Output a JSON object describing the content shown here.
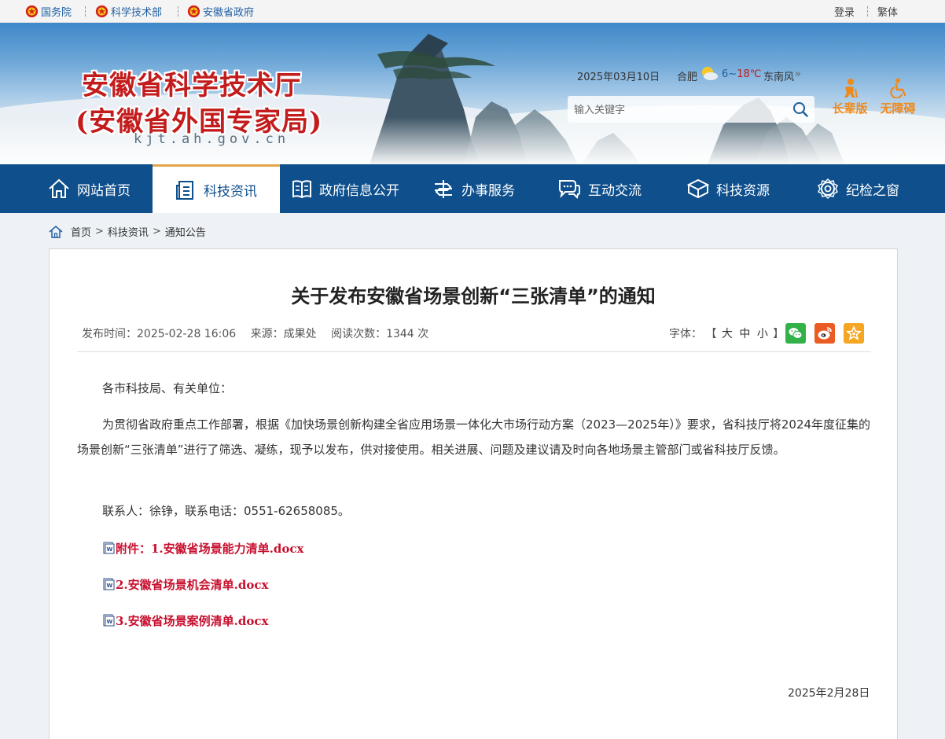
{
  "topbar": {
    "links": [
      "国务院",
      "科学技术部",
      "安徽省政府"
    ],
    "login": "登录",
    "traditional": "繁体"
  },
  "header": {
    "title_line1": "安徽省科学技术厅",
    "title_line2": "(安徽省外国专家局)",
    "domain": "kjt.ah.gov.cn",
    "date": "2025年03月10日",
    "city": "合肥",
    "temp_low": "6",
    "temp_sep": "~",
    "temp_high": "18",
    "temp_unit": "℃",
    "wind": "东南风",
    "wind_more": "»",
    "search_placeholder": "输入关键字",
    "elder_label": "长辈版",
    "accessible_label": "无障碍",
    "colors": {
      "title_red": "#c31c1c",
      "accent_orange": "#f0891b"
    }
  },
  "nav": {
    "items": [
      {
        "label": "网站首页",
        "icon": "home-icon"
      },
      {
        "label": "科技资讯",
        "icon": "news-icon",
        "active": true
      },
      {
        "label": "政府信息公开",
        "icon": "book-icon"
      },
      {
        "label": "办事服务",
        "icon": "service-icon"
      },
      {
        "label": "互动交流",
        "icon": "chat-icon"
      },
      {
        "label": "科技资源",
        "icon": "cube-icon"
      },
      {
        "label": "纪检之窗",
        "icon": "badge-icon"
      }
    ],
    "colors": {
      "bar": "#0e4f8c",
      "active_border": "#e4a64a"
    }
  },
  "breadcrumb": [
    "首页",
    "科技资讯",
    "通知公告"
  ],
  "article": {
    "title": "关于发布安徽省场景创新“三张清单”的通知",
    "publish_time": "发布时间：2025-02-28 16:06",
    "source": "来源：成果处",
    "views": "阅读次数：1344 次",
    "font_label": "字体：",
    "font_open": "【",
    "font_large": "大",
    "font_medium": "中",
    "font_small": "小",
    "font_close": "】",
    "greeting": "各市科技局、有关单位：",
    "body": "为贯彻省政府重点工作部署，根据《加快场景创新构建全省应用场景一体化大市场行动方案（2023—2025年）》要求，省科技厅将2024年度征集的场景创新“三张清单”进行了筛选、凝练，现予以发布，供对接使用。相关进展、问题及建议请及时向各地场景主管部门或省科技厅反馈。",
    "contact": "联系人：徐铮，联系电话：0551-62658085。",
    "attachments": [
      "附件：1.安徽省场景能力清单.docx",
      "2.安徽省场景机会清单.docx",
      "3.安徽省场景案例清单.docx"
    ],
    "date": "2025年2月28日",
    "share_icons": [
      "wechat-icon",
      "weibo-icon",
      "favorite-icon"
    ],
    "colors": {
      "attachment_red": "#c8102e",
      "wechat": "#33b24a",
      "weibo": "#ea5c23",
      "favorite": "#f5a623"
    }
  }
}
